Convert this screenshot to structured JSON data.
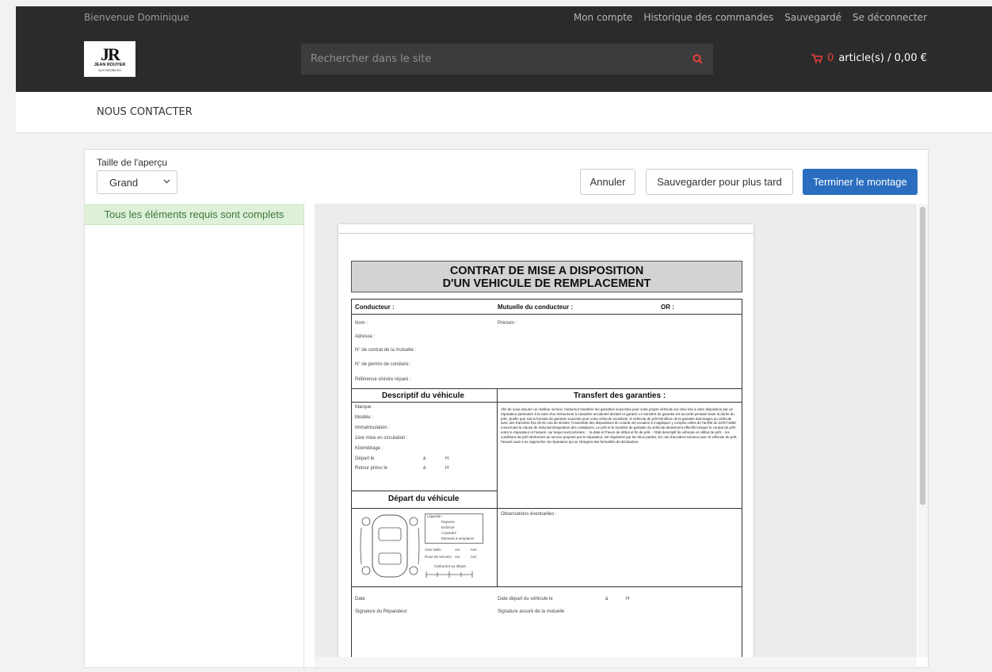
{
  "topbar": {
    "welcome": "Bienvenue Dominique",
    "links": [
      "Mon compte",
      "Historique des commandes",
      "Sauvegardé",
      "Se déconnecter"
    ],
    "search_placeholder": "Rechercher dans le site",
    "cart_count": "0",
    "cart_text": "article(s) / 0,00 €",
    "logo": {
      "mark": "JR",
      "brand": "JEAN ROUYER",
      "sub": "AUTOMOBILES"
    }
  },
  "nav": {
    "contact": "NOUS CONTACTER"
  },
  "editor": {
    "size_label": "Taille de l'aperçu",
    "size_value": "Grand",
    "cancel": "Annuler",
    "save_later": "Sauvegarder pour plus tard",
    "finish": "Terminer le montage",
    "status": "Tous les éléments requis sont complets"
  },
  "document": {
    "title_line1": "CONTRAT DE MISE A DISPOSITION",
    "title_line2": "D'UN VEHICULE DE REMPLACEMENT",
    "conducteur": "Conducteur :",
    "mutuelle": "Mutuelle du conducteur :",
    "or": "OR :",
    "nom": "Nom :",
    "prenom": "Prénom :",
    "adresse": "Adresse :",
    "contrat": "N° de contrat de la mutuelle :",
    "permis": "N° de permis de conduire :",
    "reference": "Référence sinistre réparé :",
    "descriptif": "Descriptif du véhicule",
    "transfert": "Transfert des garanties :",
    "marque": "Marque :",
    "modele": "Modèle :",
    "immat": "Immatriculation :",
    "mise_circ": "1ère mise en circulation :",
    "km": "Kilométrage :",
    "depart_le": "Départ le",
    "retour": "Retour prévu le",
    "a": "à",
    "h": "H",
    "depart_vehicule": "Départ du véhicule",
    "observations": "Observations éventuelles :",
    "legende": "Légende :",
    "rayures": "Rayures",
    "enfonce": "Enfoncé",
    "peindre": "A peindre",
    "remplacer": "Element à remplacer",
    "auto_radio": "Auto radio",
    "roue": "Roue de secours",
    "oui": "oui",
    "non": "non",
    "carburant": "Carburant au départ",
    "date": "Date",
    "date_depart": "Date départ du véhicule le",
    "sign_rep": "Signature du Réparateur",
    "sign_mut": "Signature assuré de la mutuelle",
    "transfert_text": "Afin de vous assurer un meilleur service, l'assureur transfère les garanties souscrites pour votre propre véhicule sur celui mis à votre disposition par un réparateur partenaire à la suite d'un évènement à caractère accidentel déclaré et garanti. Le transfert de garantie est accordé pendant toute la durée du prêt. Quelle que soit la formule de garantie souscrite pour votre véhicule accidenté, le véhicule de prêt bénéficie de la garantie dommages au véhicule avec une franchise fixe de En cas de sinistre, l'ensemble des dispositions du contrat ont vocation à s'appliquer y compris celles de l'arrêté du 22/07/1983 concernant la clause de réduction/majoration des cotisations. Le prêt et le transfert de garantie du véhicule deviennent effectifs lorsque le contrat de prêt entre le réparateur et l'assuré, sur lequel sont précisés : - la date et l'heure de début et fin de prêt, - l'état descriptif du véhicule en début de prêt, - les conditions de prêt inhérentes au service proposé par le réparateur, est régularisé par les deux parties. En cas d'accident survenu avec le véhicule de prêt, l'assuré aura à se rapprocher du réparateur qui se chargera des formalités de déclaration."
  }
}
